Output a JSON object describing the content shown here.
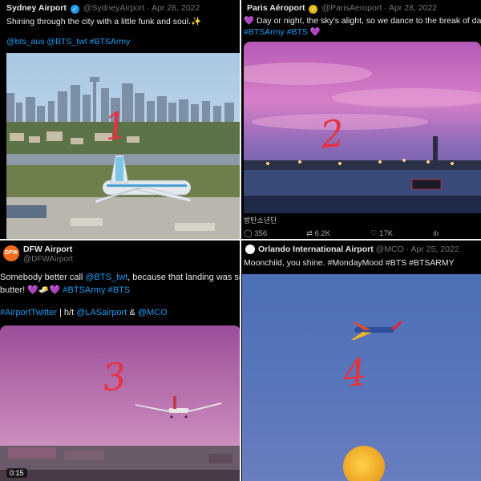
{
  "tweets": [
    {
      "name": "Sydney Airport",
      "handle_date": "@SydneyAirport · Apr 28, 2022",
      "text": "Shining through the city with a little funk and soul.✨",
      "tags": "@bts_aus @BTS_twt #BTSArmy",
      "number": "1"
    },
    {
      "name": "Paris Aéroport",
      "handle_date": "@ParisAeroport · Apr 28, 2022",
      "text_prefix": "💜",
      "text": "Day or night, the sky's alight, so we dance to the break of daw",
      "tags": "#BTSArmy #BTS 💜",
      "caption": "방탄소년단",
      "stats": {
        "replies": "356",
        "retweets": "6.2K",
        "likes": "17K"
      },
      "number": "2"
    },
    {
      "name": "DFW Airport",
      "handle": "@DFWAirport",
      "avatar_text": "DFW",
      "text_line1_a": "Somebody better call ",
      "text_line1_link": "@BTS_twt",
      "text_line1_b": ", because that landing was sm",
      "text_line2_a": "butter! 💜🧈💜 ",
      "text_line2_tags": "#BTSArmy #BTS",
      "text_line3_tag": "#AirportTwitter",
      "text_line3_mid": " | h/t ",
      "text_line3_link1": "@LASairport",
      "text_line3_amp": " & ",
      "text_line3_link2": "@MCO",
      "video_time": "0:15",
      "number": "3"
    },
    {
      "name": "Orlando International Airport",
      "handle_date": "@MCO · Apr 25, 2022",
      "text": "Moonchild, you shine. #MondayMood #BTS #BTSARMY",
      "number": "4"
    }
  ],
  "colors": {
    "accent": "#1d9bf0",
    "handwriting": "#e5333f",
    "background": "#000000"
  }
}
